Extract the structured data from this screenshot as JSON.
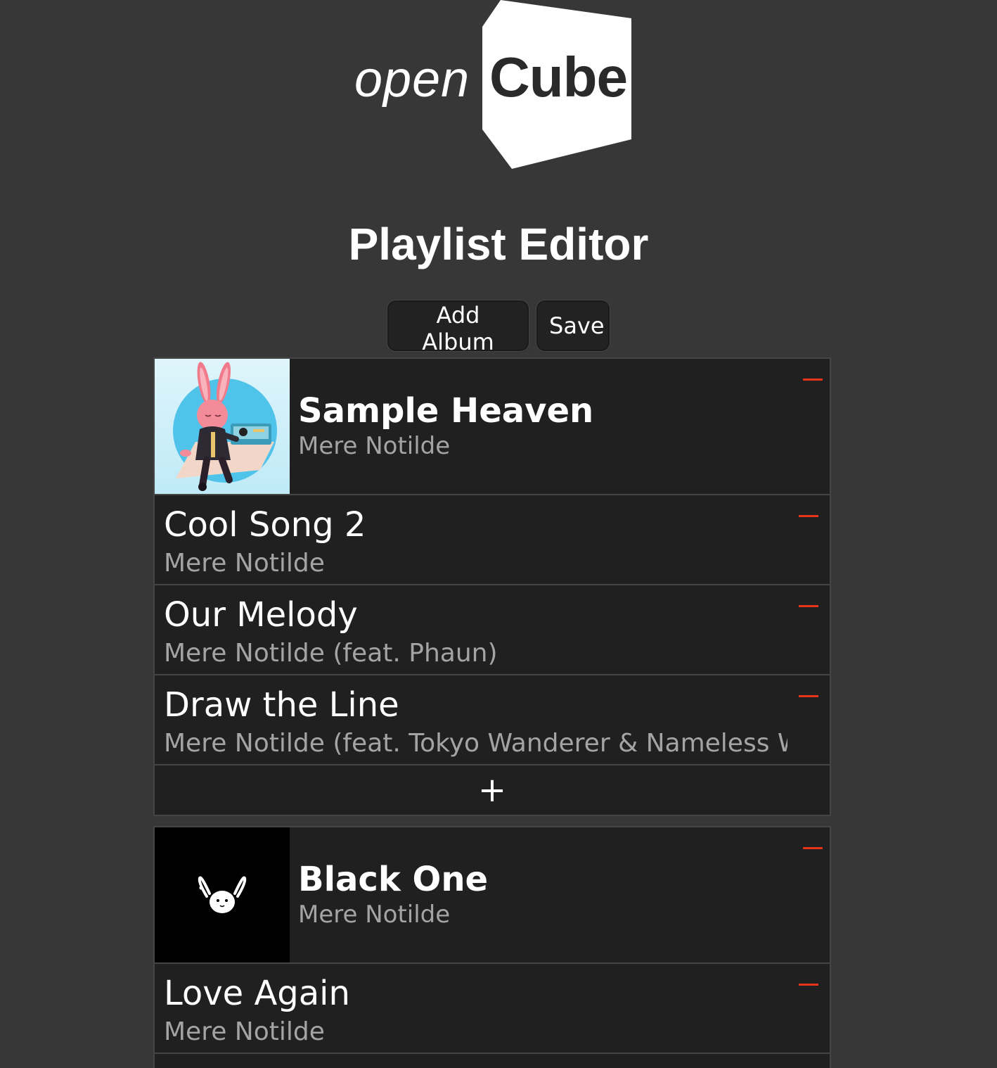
{
  "logo": {
    "word_open": "open",
    "word_cube": "Cube",
    "shape_color": "#ffffff"
  },
  "page_title": "Playlist Editor",
  "toolbar": {
    "add_album_label": "Add Album",
    "save_label": "Save"
  },
  "colors": {
    "background": "#373737",
    "panel": "#202020",
    "border": "#464646",
    "remove_accent": "#e8331b",
    "secondary_text": "#a4a4a4"
  },
  "albums": [
    {
      "title": "Sample Heaven",
      "artist": "Mere Notilde",
      "cover_icon": "bunny-girl-with-turntable-illustration",
      "tracks": [
        {
          "title": "Cool Song 2",
          "artist": "Mere Notilde"
        },
        {
          "title": "Our Melody",
          "artist": "Mere Notilde (feat. Phaun)"
        },
        {
          "title": "Draw the Line",
          "artist": "Mere Notilde (feat. Tokyo Wanderer & Nameless Wanderer)"
        }
      ],
      "add_track_label": "+"
    },
    {
      "title": "Black One",
      "artist": "Mere Notilde",
      "cover_icon": "white-bunny-head-icon",
      "tracks": [
        {
          "title": "Love Again",
          "artist": "Mere Notilde"
        }
      ]
    }
  ]
}
